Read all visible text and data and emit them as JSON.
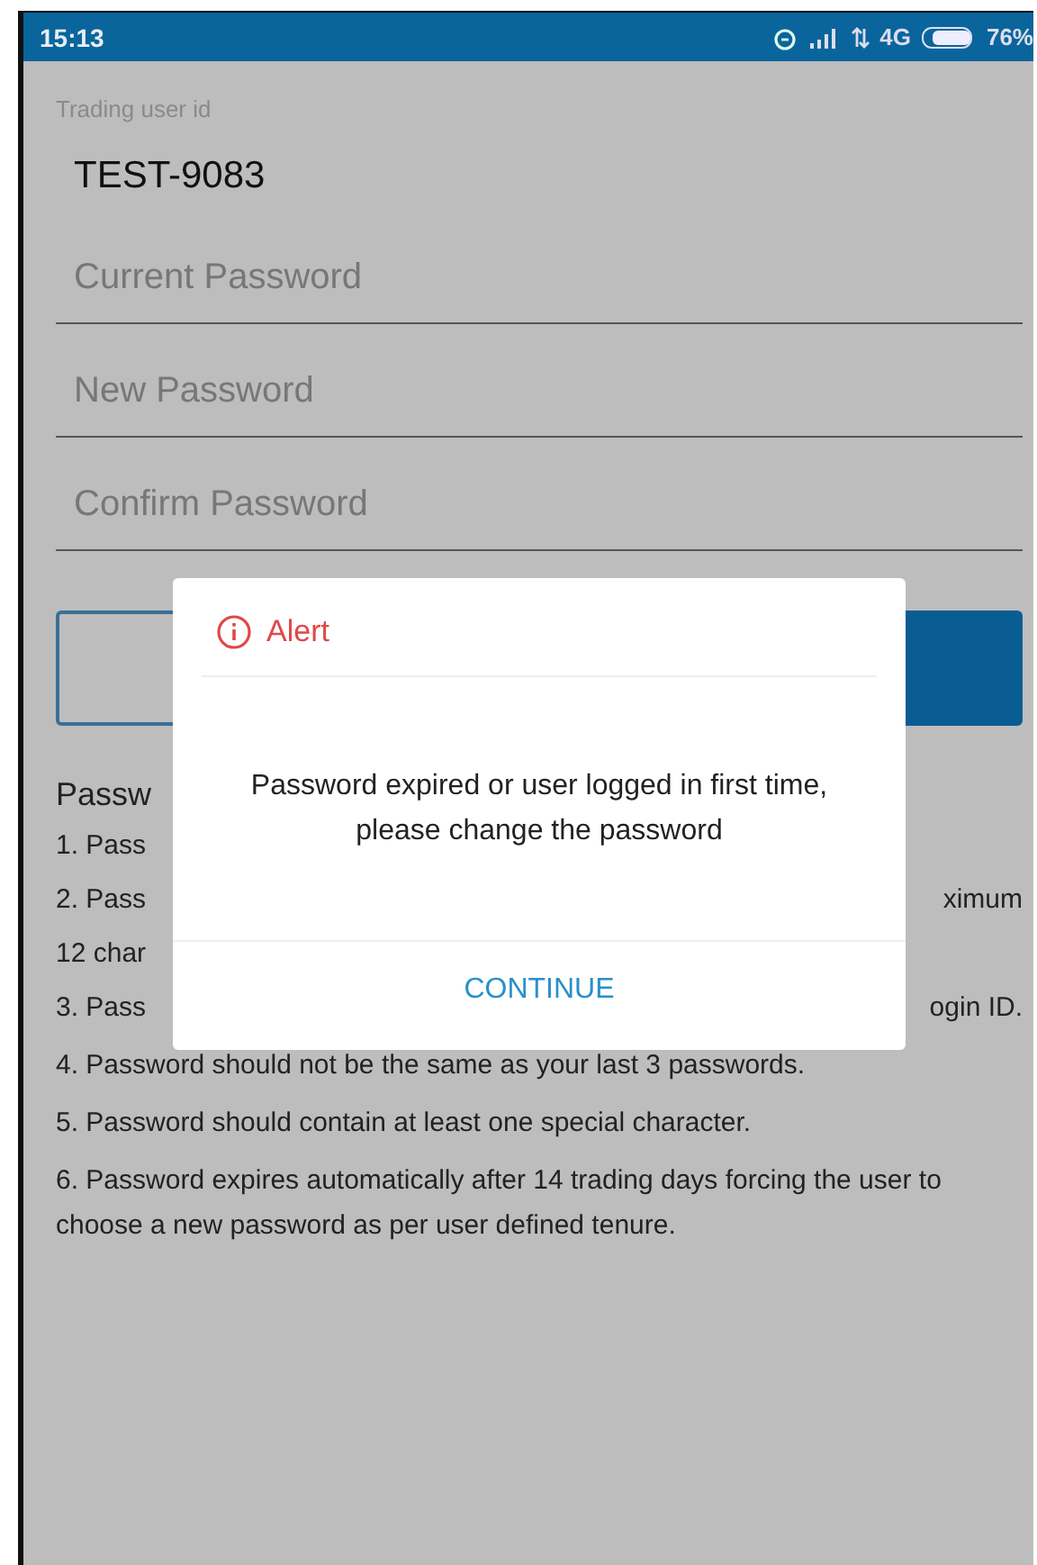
{
  "status_bar": {
    "time": "15:13",
    "network": "4G",
    "battery": "76%"
  },
  "form": {
    "user_id_label": "Trading user id",
    "user_id_value": "TEST-9083",
    "fields": [
      {
        "placeholder": "Current Password"
      },
      {
        "placeholder": "New Password"
      },
      {
        "placeholder": "Confirm Password"
      }
    ]
  },
  "rules": {
    "heading": "Passw",
    "lines": [
      {
        "left": "1. Pass"
      },
      {
        "left": "2. Pass",
        "right": "ximum"
      },
      {
        "left": "12 char"
      },
      {
        "left": "3. Pass",
        "right": "ogin ID."
      }
    ],
    "full_lines": [
      "4. Password should not be the same as your last 3 passwords.",
      "5. Password should contain at least one special character.",
      "6. Password expires automatically after 14 trading days forcing the user to choose a new password as per user defined tenure."
    ]
  },
  "dialog": {
    "title": "Alert",
    "message": "Password expired or user logged in first time, please change the password",
    "button": "CONTINUE"
  }
}
